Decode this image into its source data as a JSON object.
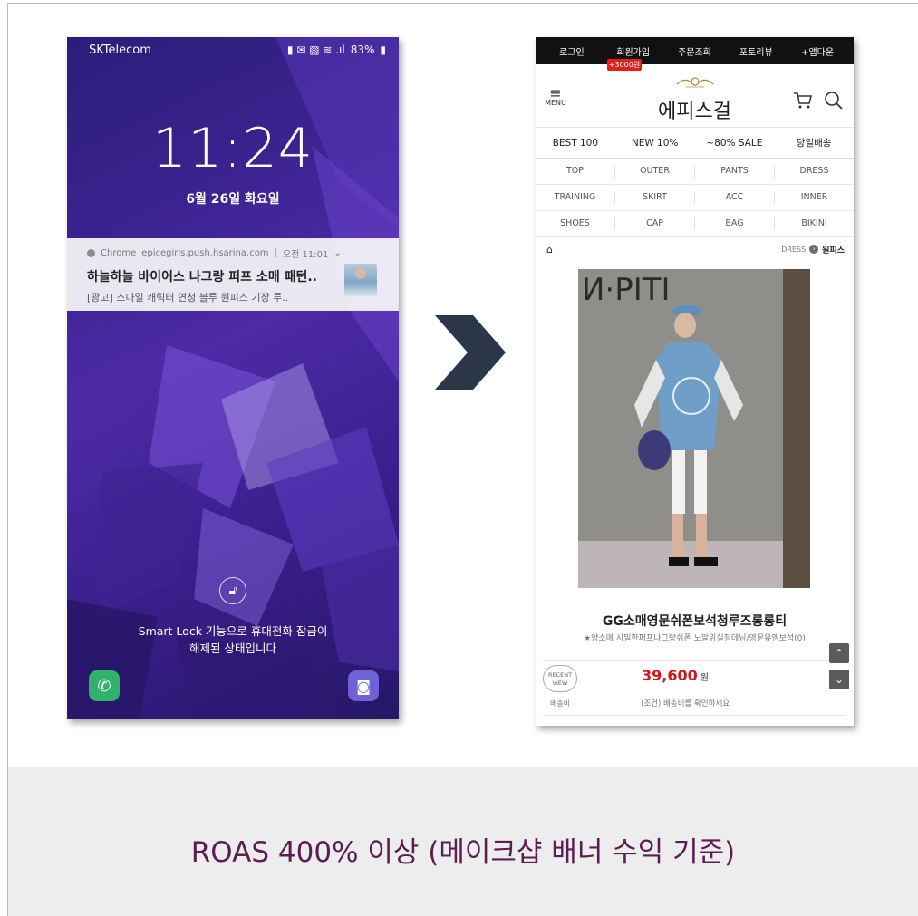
{
  "lockscreen": {
    "carrier": "SKTelecom",
    "battery": "83%",
    "time": "11:24",
    "date": "6월 26일 화요일",
    "notification": {
      "app": "Chrome",
      "source": "epicegirls.push.hsarina.com",
      "time": "오전 11:01",
      "title": "하늘하늘 바이어스 나그랑 퍼프 소매 패턴..",
      "body": "[광고] 스마일 캐릭터 연청 블루 원피스 기장 루.."
    },
    "smart_lock_line1": "Smart Lock 기능으로 휴대전화 잠금이",
    "smart_lock_line2": "해제된 상태입니다",
    "icons": {
      "phone": "phone-icon",
      "camera": "camera-icon",
      "lock": "unlock-icon"
    }
  },
  "shop": {
    "top_nav": [
      "로그인",
      "회원가입",
      "주문조회",
      "포토리뷰",
      "+앱다운"
    ],
    "coupon_badge": "+3000원",
    "menu_label": "MENU",
    "logo": "에피스걸",
    "main_categories": [
      "BEST 100",
      "NEW 10%",
      "~80% SALE",
      "당일배송"
    ],
    "category_grid": [
      [
        "TOP",
        "OUTER",
        "PANTS",
        "DRESS"
      ],
      [
        "TRAINING",
        "SKIRT",
        "ACC",
        "INNER"
      ],
      [
        "SHOES",
        "CAP",
        "BAG",
        "BIKINI"
      ]
    ],
    "breadcrumb": {
      "parent": "DRESS",
      "current": "원피스"
    },
    "product_image_text": "И·PITI",
    "product_name": "GG소매영문쉬폰보석청루즈롱롱티",
    "product_desc": "★양소매 시밀한퍼프나그랑쉬폰 노말위실청데님/영문유엠보석(0)",
    "recent_view": "RECENT VIEW",
    "price": "39,600",
    "price_unit": "원",
    "shipping_label": "배송비",
    "shipping_note": "(조건) 배송비를 확인하세요"
  },
  "caption": "ROAS 400% 이상 (메이크샵 배너 수익 기준)",
  "colors": {
    "arrow": "#2b3648",
    "caption_text": "#5a1e52",
    "price": "#d1161e",
    "coupon": "#e0201b",
    "lock_bg": "#3a238f"
  }
}
